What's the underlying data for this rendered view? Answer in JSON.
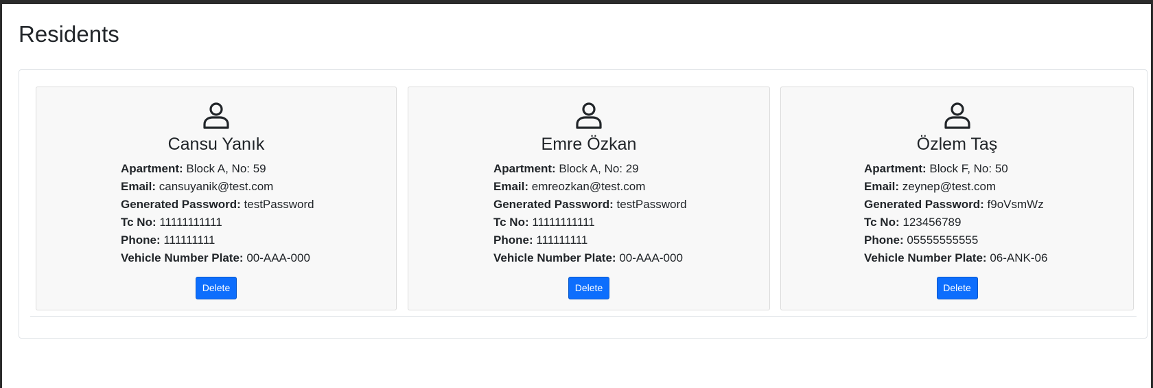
{
  "page": {
    "title": "Residents"
  },
  "labels": {
    "apartment": "Apartment:",
    "email": "Email:",
    "password": "Generated Password:",
    "tc_no": "Tc No:",
    "phone": "Phone:",
    "plate": "Vehicle Number Plate:"
  },
  "residents": [
    {
      "name": "Cansu Yanık",
      "apartment": "Block A, No: 59",
      "email": "cansuyanik@test.com",
      "password": "testPassword",
      "tc_no": "11111111111",
      "phone": "111111111",
      "plate": "00-AAA-000",
      "delete_label": "Delete"
    },
    {
      "name": "Emre Özkan",
      "apartment": "Block A, No: 29",
      "email": "emreozkan@test.com",
      "password": "testPassword",
      "tc_no": "11111111111",
      "phone": "111111111",
      "plate": "00-AAA-000",
      "delete_label": "Delete"
    },
    {
      "name": "Özlem Taş",
      "apartment": "Block F, No: 50",
      "email": "zeynep@test.com",
      "password": "f9oVsmWz",
      "tc_no": "123456789",
      "phone": "05555555555",
      "plate": "06-ANK-06",
      "delete_label": "Delete"
    }
  ],
  "icons": {
    "avatar": "person-icon"
  },
  "colors": {
    "primary": "#0d6efd",
    "card_bg": "#f8f8f8",
    "text": "#212529"
  }
}
